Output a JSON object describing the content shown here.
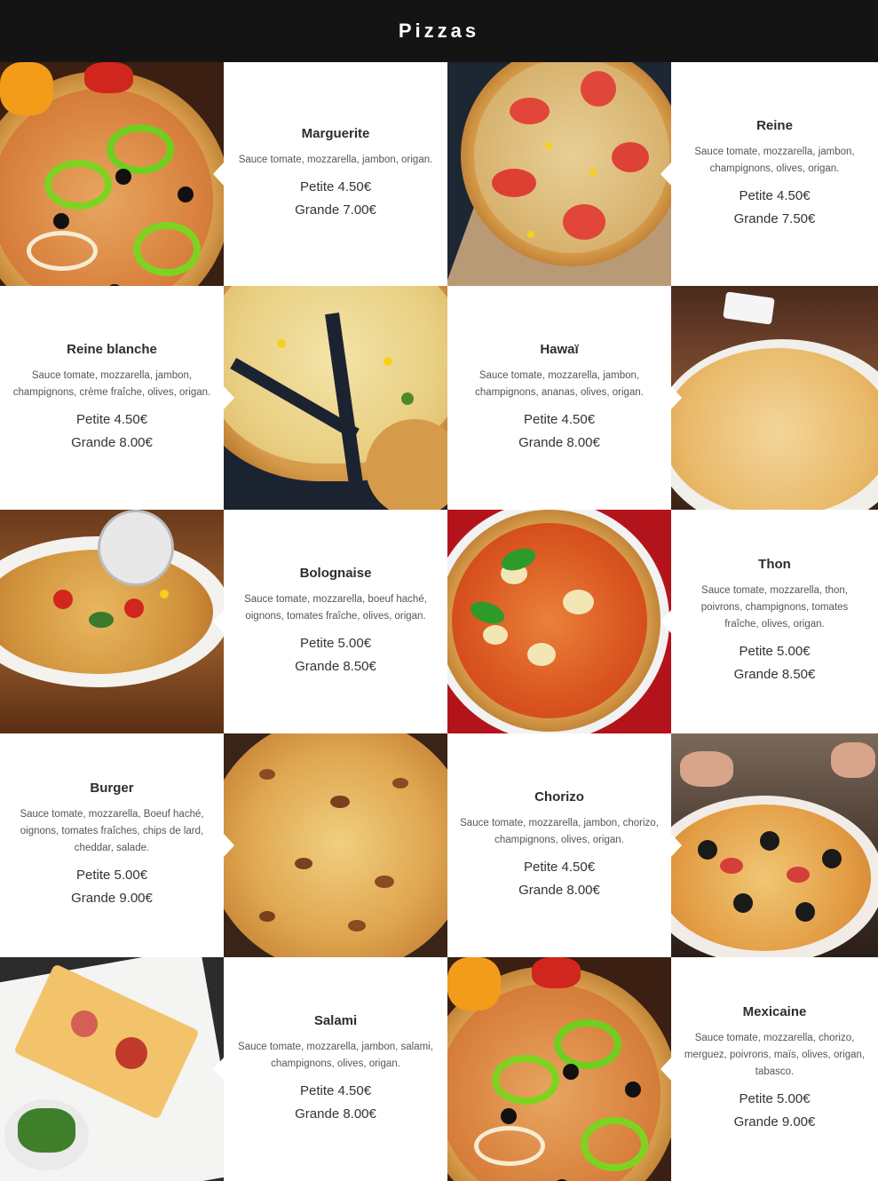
{
  "page": {
    "title": "Pizzas"
  },
  "pizzas": [
    {
      "name": "Marguerite",
      "desc": "Sauce tomate, mozzarella, jambon, origan.",
      "petite": "Petite 4.50€",
      "grande": "Grande 7.00€"
    },
    {
      "name": "Reine",
      "desc": "Sauce tomate, mozzarella, jambon, champignons, olives, origan.",
      "petite": "Petite 4.50€",
      "grande": "Grande 7.50€"
    },
    {
      "name": "Reine blanche",
      "desc": "Sauce tomate, mozzarella, jambon, champignons, crème fraîche, olives, origan.",
      "petite": "Petite 4.50€",
      "grande": "Grande 8.00€"
    },
    {
      "name": "Hawaï",
      "desc": "Sauce tomate, mozzarella, jambon, champignons, ananas, olives, origan.",
      "petite": "Petite 4.50€",
      "grande": "Grande 8.00€"
    },
    {
      "name": "Bolognaise",
      "desc": "Sauce tomate, mozzarella, boeuf haché, oignons, tomates fraîche, olives, origan.",
      "petite": "Petite 5.00€",
      "grande": "Grande 8.50€"
    },
    {
      "name": "Thon",
      "desc": "Sauce tomate, mozzarella, thon, poivrons, champignons, tomates fraîche, olives, origan.",
      "petite": "Petite 5.00€",
      "grande": "Grande 8.50€"
    },
    {
      "name": "Burger",
      "desc": "Sauce tomate, mozzarella, Boeuf haché, oignons, tomates fraîches, chips de lard, cheddar, salade.",
      "petite": "Petite 5.00€",
      "grande": "Grande 9.00€"
    },
    {
      "name": "Chorizo",
      "desc": "Sauce tomate, mozzarella, jambon, chorizo, champignons, olives, origan.",
      "petite": "Petite 4.50€",
      "grande": "Grande 8.00€"
    },
    {
      "name": "Salami",
      "desc": "Sauce tomate, mozzarella, jambon, salami, champignons, olives, origan.",
      "petite": "Petite 4.50€",
      "grande": "Grande 8.00€"
    },
    {
      "name": "Mexicaine",
      "desc": "Sauce tomate, mozzarella, chorizo, merguez, poivrons, maïs, olives, origan, tabasco.",
      "petite": "Petite 5.00€",
      "grande": "Grande 9.00€"
    }
  ],
  "colors": {
    "header_bg": "#141414",
    "header_text": "#ffffff",
    "text_dark": "#2d2d2d"
  }
}
